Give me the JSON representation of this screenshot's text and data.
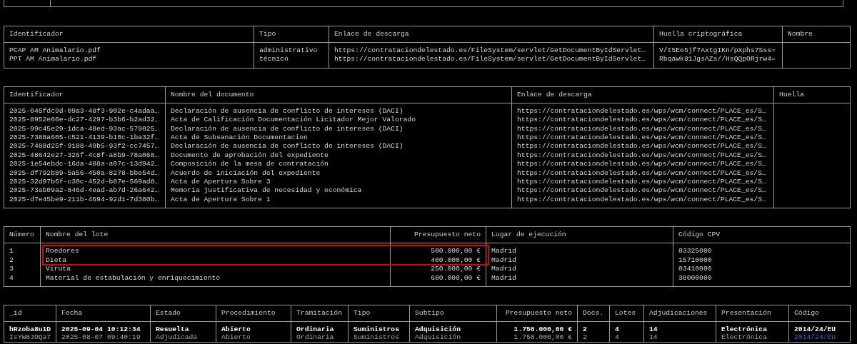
{
  "files": {
    "columns": [
      "Identificador",
      "Tipo",
      "Enlace de descarga",
      "Huella criptográfica",
      "Nombre"
    ],
    "rows": [
      [
        "PCAP AM Animalario.pdf",
        "administrativo",
        "https://contrataciondelestado.es/FileSystem/servlet/GetDocumentByIdServlet…",
        "V/t5Ee5jf7AxtgIKn/pXphs7Sss=",
        ""
      ],
      [
        "PPT AM Animalario.pdf",
        "técnico",
        "https://contrataciondelestado.es/FileSystem/servlet/GetDocumentByIdServlet…",
        "Rbqawk81JgsAZs//HsQQpORjrw4=",
        ""
      ]
    ]
  },
  "documents": {
    "columns": [
      "Identificador",
      "Nombre del documento",
      "Enlace de descarga",
      "Huella"
    ],
    "rows": [
      [
        "2025-045fdc9d-09a3-48f3-902e-c4adaa…",
        "Declaración de ausencia de conflicto de intereses (DACI)",
        "https://contrataciondelestado.es/wps/wcm/connect/PLACE_es/S…",
        ""
      ],
      [
        "2025-8952e66e-dc27-4297-b3b6-b2ad32…",
        "Acta de Calificación Documentación Licitador Mejor Valorado",
        "https://contrataciondelestado.es/wps/wcm/connect/PLACE_es/S…",
        ""
      ],
      [
        "2025-99c45e29-1dca-48ed-93ac-579025…",
        "Declaración de ausencia de conflicto de intereses (DACI)",
        "https://contrataciondelestado.es/wps/wcm/connect/PLACE_es/S…",
        ""
      ],
      [
        "2025-7388a605-c521-4139-b10c-1ba32f…",
        "Acta de Subsanación Documentacion",
        "https://contrataciondelestado.es/wps/wcm/connect/PLACE_es/S…",
        ""
      ],
      [
        "2025-7488d25f-9188-49b5-93f2-cc7457…",
        "Declaración de ausencia de conflicto de intereses (DACI)",
        "https://contrataciondelestado.es/wps/wcm/connect/PLACE_es/S…",
        ""
      ],
      [
        "2025-48642e27-326f-4c8f-a8b9-78a068…",
        "Documento de aprobación del expediente",
        "https://contrataciondelestado.es/wps/wcm/connect/PLACE_es/S…",
        ""
      ],
      [
        "2025-1e54ebdc-16da-488a-a07c-13d942…",
        "Composición de la mesa de contratación",
        "https://contrataciondelestado.es/wps/wcm/connect/PLACE_es/S…",
        ""
      ],
      [
        "2025-df792b89-5a56-450a-8278-bbe54d…",
        "Acuerdo de iniciación del expediente",
        "https://contrataciondelestado.es/wps/wcm/connect/PLACE_es/S…",
        ""
      ],
      [
        "2025-32d97b6f-c30c-452d-b87e-569ad8…",
        "Acta de Apertura Sobre 3",
        "https://contrataciondelestado.es/wps/wcm/connect/PLACE_es/S…",
        ""
      ],
      [
        "2025-73ab09a2-846d-4ead-ab7d-26a642…",
        "Memoria justificativa de necesidad y económica",
        "https://contrataciondelestado.es/wps/wcm/connect/PLACE_es/S…",
        ""
      ],
      [
        "2025-d7e45be9-211b-4694-92d1-7d380b…",
        "Acta de Apertura Sobre 1",
        "https://contrataciondelestado.es/wps/wcm/connect/PLACE_es/S…",
        ""
      ]
    ]
  },
  "lots": {
    "columns": [
      "Número",
      "Nombre del lote",
      "Presupuesto neto",
      "Lugar de ejecución",
      "Código CPV"
    ],
    "rows": [
      {
        "cells": [
          "1",
          "Roedores",
          "500.000,00 €",
          "Madrid",
          "03325000"
        ],
        "highlighted": true
      },
      {
        "cells": [
          "2",
          "Dieta",
          "400.000,00 €",
          "Madrid",
          "15710000"
        ],
        "highlighted": true
      },
      {
        "cells": [
          "3",
          "Viruta",
          "250.000,00 €",
          "Madrid",
          "03410000"
        ],
        "highlighted": false
      },
      {
        "cells": [
          "4",
          "Material de estabulación y enriquecimiento",
          "600.000,00 €",
          "Madrid",
          "38000000"
        ],
        "highlighted": false
      }
    ]
  },
  "tenders": {
    "columns": [
      "_id",
      "Fecha",
      "Estado",
      "Procedimiento",
      "Tramitación",
      "Tipo",
      "Subtipo",
      "Presupuesto neto",
      "Docs.",
      "Lotes",
      "Adjudicaciones",
      "Presentación",
      "Código"
    ],
    "rows": [
      {
        "cells": [
          "hRzoba8u1D",
          "2025-09-04 10:12:34",
          "Resuelta",
          "Abierto",
          "Ordinaria",
          "Suministros",
          "Adquisición",
          "1.750.000,00 €",
          "2",
          "4",
          "14",
          "Electrónica",
          "2014/24/EU"
        ],
        "selected": true
      },
      {
        "cells": [
          "IsYW8JOQa7",
          "2025-08-07 09:40:19",
          "Adjudicada",
          "Abierto",
          "Ordinaria",
          "Suministros",
          "Adquisición",
          "1.750.000,00 €",
          "2",
          "4",
          "14",
          "Electrónica",
          "2014/24/EU"
        ],
        "selected": false
      }
    ]
  }
}
